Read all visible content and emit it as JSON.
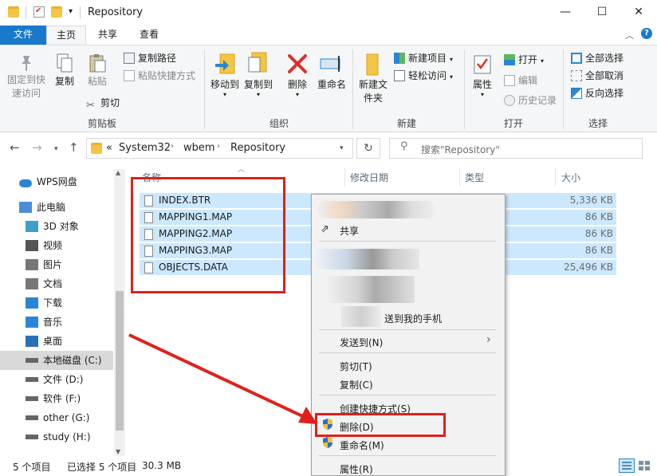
{
  "window": {
    "title": "Repository",
    "minimize_glyph": "—",
    "maximize_glyph": "☐",
    "close_glyph": "✕"
  },
  "tabs": [
    "文件",
    "主页",
    "共享",
    "查看"
  ],
  "ribbon": {
    "clipboard": {
      "pin": "固定到快速访问",
      "copy": "复制",
      "paste": "粘贴",
      "copy_path": "复制路径",
      "paste_shortcut": "粘贴快捷方式",
      "cut": "剪切",
      "group": "剪贴板"
    },
    "organize": {
      "move_to": "移动到",
      "copy_to": "复制到",
      "delete": "删除",
      "rename": "重命名",
      "group": "组织"
    },
    "new": {
      "new_folder": "新建文件夹",
      "new_item": "新建项目",
      "easy_access": "轻松访问",
      "group": "新建"
    },
    "open": {
      "properties": "属性",
      "open": "打开",
      "edit": "编辑",
      "history": "历史记录",
      "group": "打开"
    },
    "select": {
      "select_all": "全部选择",
      "select_none": "全部取消",
      "invert": "反向选择",
      "group": "选择"
    }
  },
  "address": {
    "crumbs": [
      "«",
      "System32",
      "wbem",
      "Repository"
    ],
    "search_placeholder": "搜索\"Repository\""
  },
  "nav_pane": [
    {
      "label": "WPS网盘",
      "icon": "cloud-icon"
    },
    {
      "label": "此电脑",
      "icon": "computer-icon"
    },
    {
      "label": "3D 对象",
      "icon": "cube-icon"
    },
    {
      "label": "视频",
      "icon": "video-icon"
    },
    {
      "label": "图片",
      "icon": "picture-icon"
    },
    {
      "label": "文档",
      "icon": "document-icon"
    },
    {
      "label": "下载",
      "icon": "download-icon"
    },
    {
      "label": "音乐",
      "icon": "music-icon"
    },
    {
      "label": "桌面",
      "icon": "desktop-icon"
    },
    {
      "label": "本地磁盘 (C:)",
      "icon": "drive-icon"
    },
    {
      "label": "文件 (D:)",
      "icon": "drive-icon"
    },
    {
      "label": "软件 (F:)",
      "icon": "drive-icon"
    },
    {
      "label": "other (G:)",
      "icon": "drive-icon"
    },
    {
      "label": "study (H:)",
      "icon": "drive-icon"
    }
  ],
  "columns": {
    "name": "名称",
    "modified": "修改日期",
    "type": "类型",
    "size": "大小"
  },
  "files": [
    {
      "name": "INDEX.BTR",
      "size": "5,336 KB"
    },
    {
      "name": "MAPPING1.MAP",
      "size": "86 KB"
    },
    {
      "name": "MAPPING2.MAP",
      "size": "86 KB"
    },
    {
      "name": "MAPPING3.MAP",
      "size": "86 KB"
    },
    {
      "name": "OBJECTS.DATA",
      "size": "25,496 KB"
    }
  ],
  "context_menu": {
    "share": "共享",
    "send_phone_tail": "送到我的手机",
    "send_to": "发送到(N)",
    "cut": "剪切(T)",
    "copy": "复制(C)",
    "create_shortcut": "创建快捷方式(S)",
    "delete": "删除(D)",
    "rename": "重命名(M)",
    "properties": "属性(R)"
  },
  "status": {
    "count": "5 个项目",
    "selected": "已选择 5 个项目",
    "size": "30.3 MB"
  },
  "colors": {
    "accent": "#1979ca",
    "selection": "#cce8ff",
    "annotation_red": "#e0201b"
  }
}
